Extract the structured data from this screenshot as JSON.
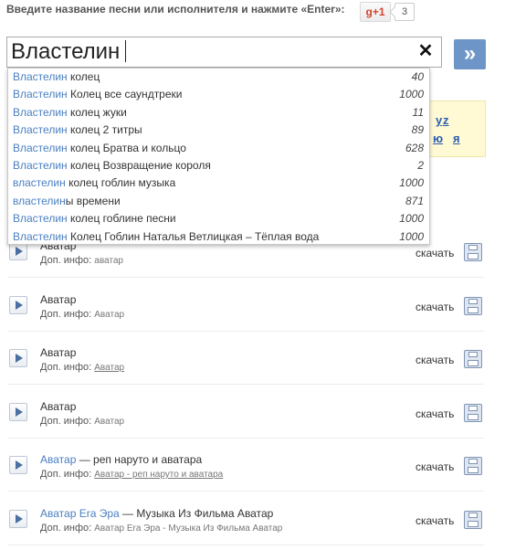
{
  "header": {
    "prompt": "Введите название песни или исполнителя и нажмите «Enter»:",
    "gplus_label": "g+1",
    "gplus_count": "3"
  },
  "search": {
    "value": "Властелин",
    "clear_icon": "close-icon",
    "go_label": "»"
  },
  "alphabet": {
    "row1": [
      "y",
      "z"
    ],
    "row2": [
      "ю",
      "я"
    ]
  },
  "suggestions": [
    {
      "hl": "Властелин",
      "rest": " колец",
      "count": "40"
    },
    {
      "hl": "Властелин",
      "rest": " Колец все саундтреки",
      "count": "1000"
    },
    {
      "hl": "Властелин",
      "rest": " колец жуки",
      "count": "11"
    },
    {
      "hl": "Властелин",
      "rest": " колец 2 титры",
      "count": "89"
    },
    {
      "hl": "Властелин",
      "rest": " колец Братва и кольцо",
      "count": "628"
    },
    {
      "hl": "Властелин",
      "rest": " колец Возвращение короля",
      "count": "2"
    },
    {
      "hl": "властелин",
      "rest": " колец гоблин музыка",
      "count": "1000"
    },
    {
      "hl": "властелин",
      "rest": "ы времени",
      "count": "871"
    },
    {
      "hl": "Властелин",
      "rest": " колец гоблине песни",
      "count": "1000"
    },
    {
      "hl": "Властелин",
      "rest": " Колец Гоблин Наталья Ветлицкая – Тёплая вода",
      "count": "1000"
    }
  ],
  "tracks": [
    {
      "title_link": "",
      "title": "Аватар",
      "info_label": "Доп. инфо:",
      "info": "аватар",
      "info_link": false,
      "download": "скачать"
    },
    {
      "title_link": "",
      "title": "Аватар",
      "info_label": "Доп. инфо:",
      "info": "Аватар",
      "info_link": false,
      "download": "скачать"
    },
    {
      "title_link": "",
      "title": "Аватар",
      "info_label": "Доп. инфо:",
      "info": "Аватар",
      "info_link": true,
      "download": "скачать"
    },
    {
      "title_link": "",
      "title": "Аватар",
      "info_label": "Доп. инфо:",
      "info": "Аватар",
      "info_link": false,
      "download": "скачать"
    },
    {
      "title_link": "Аватар",
      "title": " — реп наруто и аватара",
      "info_label": "Доп. инфо:",
      "info": "Аватар - реп наруто и аватара",
      "info_link": true,
      "download": "скачать"
    },
    {
      "title_link": "Аватар Era Эра",
      "title": " — Музыка Из Фильма Аватар",
      "info_label": "Доп. инфо:",
      "info": "Аватар Era Эра - Музыка Из Фильма Аватар",
      "info_link": false,
      "download": "скачать"
    }
  ]
}
